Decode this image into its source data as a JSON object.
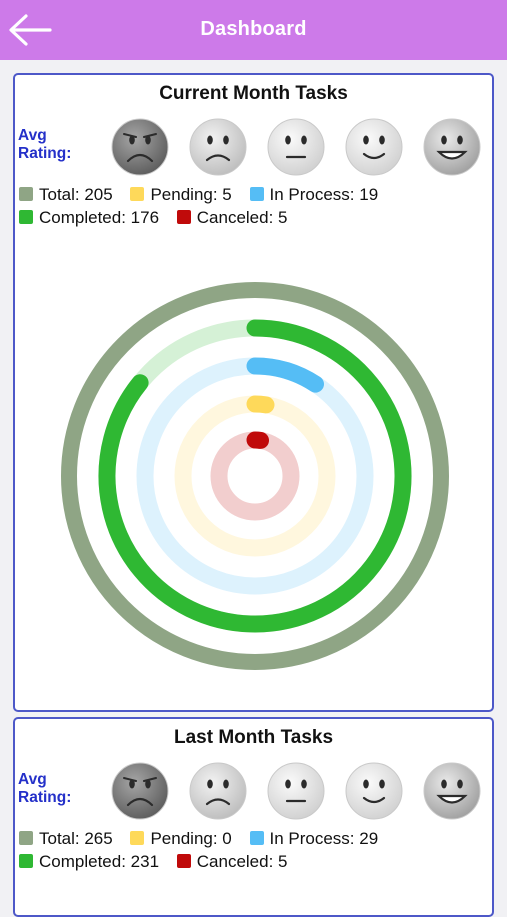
{
  "header": {
    "title": "Dashboard"
  },
  "colors": {
    "total": "#8fa585",
    "pending": "#fed95a",
    "in_process": "#55bdf5",
    "completed": "#2fb833",
    "canceled": "#c00a0a"
  },
  "current": {
    "title": "Current Month Tasks",
    "avg_label_1": "Avg",
    "avg_label_2": "Rating:",
    "legend": {
      "total": "Total: 205",
      "pending": "Pending: 5",
      "in_process": "In Process: 19",
      "completed": "Completed: 176",
      "canceled": "Canceled: 5"
    }
  },
  "last": {
    "title": "Last Month Tasks",
    "avg_label_1": "Avg",
    "avg_label_2": "Rating:",
    "legend": {
      "total": "Total: 265",
      "pending": "Pending: 0",
      "in_process": "In Process: 29",
      "completed": "Completed: 231",
      "canceled": "Canceled: 5"
    }
  },
  "faces": [
    "very-sad",
    "sad",
    "neutral",
    "happy",
    "very-happy"
  ],
  "chart_data": {
    "type": "radial-bar",
    "total": 205,
    "series": [
      {
        "name": "Completed",
        "value": 176,
        "color": "#2fb833"
      },
      {
        "name": "In Process",
        "value": 19,
        "color": "#55bdf5"
      },
      {
        "name": "Pending",
        "value": 5,
        "color": "#fed95a"
      },
      {
        "name": "Canceled",
        "value": 5,
        "color": "#c00a0a"
      }
    ]
  }
}
